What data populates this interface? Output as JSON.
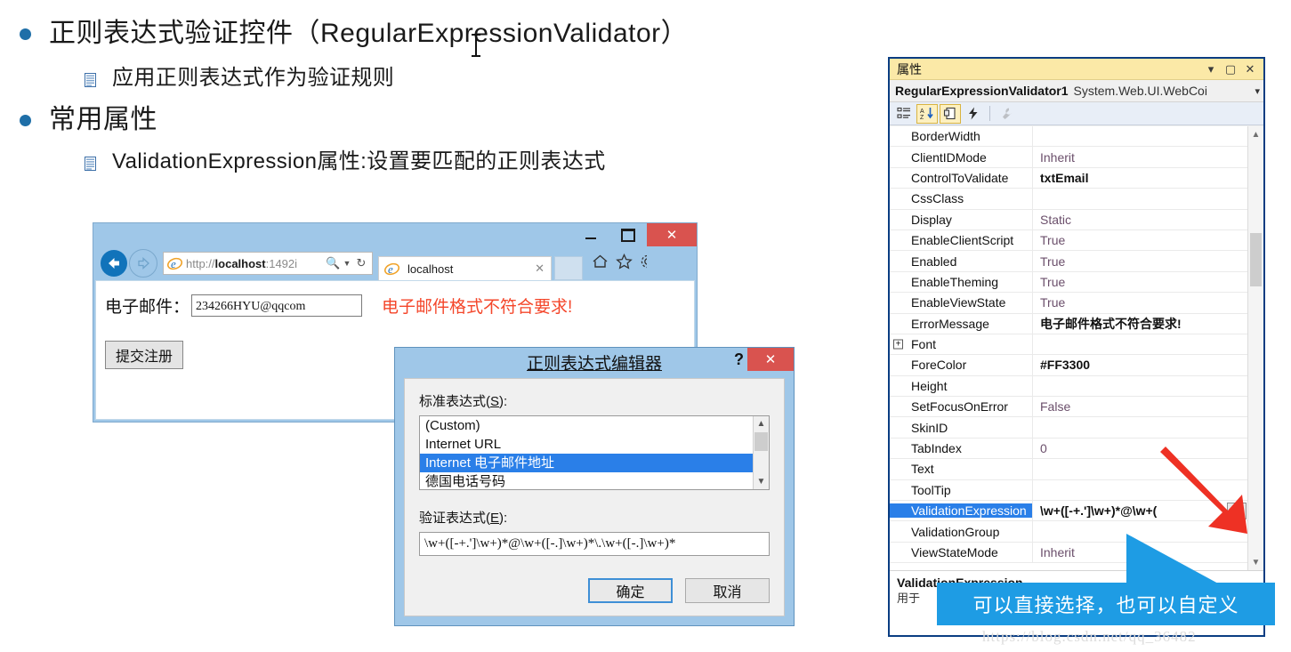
{
  "slide": {
    "bullets": [
      {
        "level": 1,
        "text": "正则表达式验证控件（RegularExpressionValidator）"
      },
      {
        "level": 2,
        "text": "应用正则表达式作为验证规则"
      },
      {
        "level": 1,
        "text": "常用属性"
      },
      {
        "level": 2,
        "text": "ValidationExpression属性:设置要匹配的正则表达式"
      }
    ]
  },
  "browser": {
    "url_prefix": "http://",
    "url_host": "localhost",
    "url_suffix": ":1492i",
    "search_icon": "search-icon",
    "dropdown_icon": "chevron-down-icon",
    "refresh_icon": "refresh-icon",
    "back_icon": "arrow-left-icon",
    "forward_icon": "arrow-right-icon",
    "tab_title": "localhost",
    "tab_close": "✕",
    "minimize": "—",
    "maximize": "▢",
    "close": "✕",
    "home_icon": "home-icon",
    "favorites_icon": "star-icon",
    "tools_icon": "gear-icon",
    "page": {
      "email_label": "电子邮件：",
      "email_value": "234266HYU@qqcom",
      "email_error": "电子邮件格式不符合要求!",
      "submit_label": "提交注册"
    }
  },
  "regex_dialog": {
    "title": "正则表达式编辑器",
    "help": "?",
    "close": "✕",
    "std_label_pre": "标准表达式(",
    "std_label_key": "S",
    "std_label_post": "):",
    "std_items": [
      {
        "label": "(Custom)",
        "selected": false
      },
      {
        "label": "Internet URL",
        "selected": false
      },
      {
        "label": "Internet 电子邮件地址",
        "selected": true
      },
      {
        "label": "德国电话号码",
        "selected": false
      }
    ],
    "expr_label_pre": "验证表达式(",
    "expr_label_key": "E",
    "expr_label_post": "):",
    "expression": "\\w+([-+.']\\w+)*@\\w+([-.]\\w+)*\\.\\w+([-.]\\w+)*",
    "ok_label": "确定",
    "cancel_label": "取消"
  },
  "properties_panel": {
    "title": "属性",
    "title_buttons": [
      "▾",
      "▢",
      "✕"
    ],
    "object_name": "RegularExpressionValidator1",
    "object_type": "System.Web.UI.WebCoi",
    "object_caret": "▾",
    "toolbar": [
      {
        "name": "categorized-view-icon",
        "active": false
      },
      {
        "name": "alphabetical-sort-icon",
        "active": true
      },
      {
        "name": "properties-page-icon",
        "active": true
      },
      {
        "name": "events-icon",
        "active": false
      },
      {
        "name": "property-pages-wrench-icon",
        "active": false,
        "disabled": true
      }
    ],
    "rows": [
      {
        "name": "BorderWidth",
        "value": "",
        "bold": false,
        "selected": false,
        "expandable": false
      },
      {
        "name": "ClientIDMode",
        "value": "Inherit",
        "bold": false,
        "selected": false,
        "expandable": false
      },
      {
        "name": "ControlToValidate",
        "value": "txtEmail",
        "bold": true,
        "selected": false,
        "expandable": false
      },
      {
        "name": "CssClass",
        "value": "",
        "bold": false,
        "selected": false,
        "expandable": false
      },
      {
        "name": "Display",
        "value": "Static",
        "bold": false,
        "selected": false,
        "expandable": false
      },
      {
        "name": "EnableClientScript",
        "value": "True",
        "bold": false,
        "selected": false,
        "expandable": false
      },
      {
        "name": "Enabled",
        "value": "True",
        "bold": false,
        "selected": false,
        "expandable": false
      },
      {
        "name": "EnableTheming",
        "value": "True",
        "bold": false,
        "selected": false,
        "expandable": false
      },
      {
        "name": "EnableViewState",
        "value": "True",
        "bold": false,
        "selected": false,
        "expandable": false
      },
      {
        "name": "ErrorMessage",
        "value": "电子邮件格式不符合要求!",
        "bold": true,
        "selected": false,
        "expandable": false
      },
      {
        "name": "Font",
        "value": "",
        "bold": false,
        "selected": false,
        "expandable": true
      },
      {
        "name": "ForeColor",
        "value": "#FF3300",
        "bold": true,
        "selected": false,
        "expandable": false
      },
      {
        "name": "Height",
        "value": "",
        "bold": false,
        "selected": false,
        "expandable": false
      },
      {
        "name": "SetFocusOnError",
        "value": "False",
        "bold": false,
        "selected": false,
        "expandable": false
      },
      {
        "name": "SkinID",
        "value": "",
        "bold": false,
        "selected": false,
        "expandable": false
      },
      {
        "name": "TabIndex",
        "value": "0",
        "bold": false,
        "selected": false,
        "expandable": false
      },
      {
        "name": "Text",
        "value": "",
        "bold": false,
        "selected": false,
        "expandable": false
      },
      {
        "name": "ToolTip",
        "value": "",
        "bold": false,
        "selected": false,
        "expandable": false
      },
      {
        "name": "ValidationExpression",
        "value": "\\w+([-+.']\\w+)*@\\w+(",
        "bold": true,
        "selected": true,
        "expandable": false,
        "has_ellipsis": true,
        "ellipsis_label": "..."
      },
      {
        "name": "ValidationGroup",
        "value": "",
        "bold": false,
        "selected": false,
        "expandable": false
      },
      {
        "name": "ViewStateMode",
        "value": "Inherit",
        "bold": false,
        "selected": false,
        "expandable": false
      }
    ],
    "description_title": "ValidationExpression",
    "description_body": "用于"
  },
  "callout": {
    "text": "可以直接选择，也可以自定义",
    "color": "#1e9ce4"
  },
  "arrow": {
    "name": "red-arrow",
    "color": "#ee3124"
  },
  "watermark": "https://blog.csdn.net/qq_36482"
}
